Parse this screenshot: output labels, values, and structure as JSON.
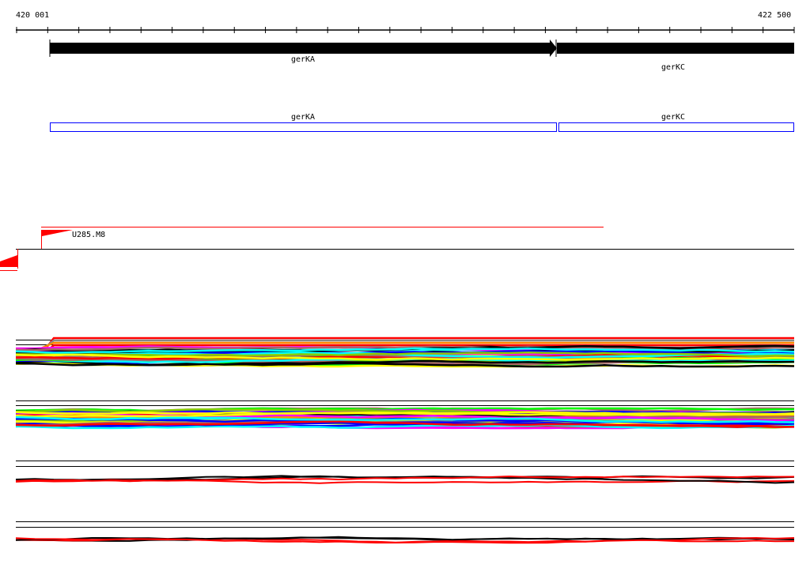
{
  "ruler": {
    "start_label": "420 001",
    "end_label": "422 500",
    "start": 420001,
    "end": 422500
  },
  "genes": [
    {
      "name": "gerKA",
      "start": 420001,
      "end": 421630,
      "strand": "+"
    },
    {
      "name": "gerKC",
      "start": 421630,
      "end": 422500,
      "strand": "+"
    }
  ],
  "annotation_boxes": [
    {
      "name": "gerKA"
    },
    {
      "name": "gerKC"
    }
  ],
  "feature": {
    "label": "U285.M8"
  },
  "colors": {
    "gene": "#000000",
    "annotation": "#0000ff",
    "feature": "#ff0000",
    "track_palette": [
      "#ff0000",
      "#ff00ff",
      "#00ffff",
      "#00ff00",
      "#ffff00",
      "#0000ff",
      "#888888",
      "#000000",
      "#aa6666",
      "#88cc00",
      "#ff8800"
    ]
  },
  "tracks": [
    {
      "id": "track-1",
      "type": "multi"
    },
    {
      "id": "track-2",
      "type": "multi"
    },
    {
      "id": "track-3",
      "type": "pair"
    },
    {
      "id": "track-4",
      "type": "pair"
    }
  ]
}
